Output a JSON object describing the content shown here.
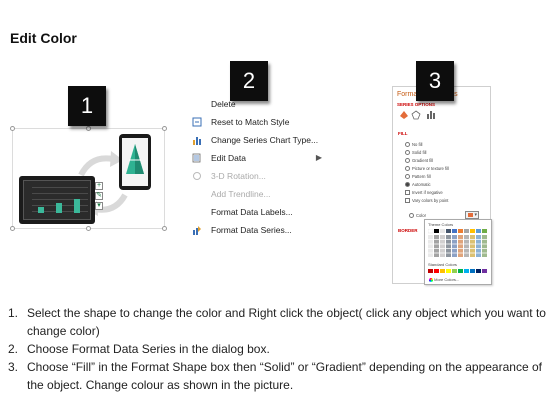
{
  "page": {
    "title": "Edit Color"
  },
  "badges": [
    "1",
    "2",
    "3"
  ],
  "context_menu": {
    "items": [
      {
        "label": "Delete",
        "icon": "delete-icon",
        "disabled": false,
        "submenu": false
      },
      {
        "label": "Reset to Match Style",
        "icon": "reset-style-icon",
        "disabled": false,
        "submenu": false
      },
      {
        "label": "Change Series Chart Type...",
        "icon": "chart-type-icon",
        "disabled": false,
        "submenu": false
      },
      {
        "label": "Edit Data",
        "icon": "edit-data-icon",
        "disabled": false,
        "submenu": true
      },
      {
        "label": "3-D Rotation...",
        "icon": "rotation-icon",
        "disabled": true,
        "submenu": false
      },
      {
        "label": "Add Trendline...",
        "icon": "",
        "disabled": true,
        "submenu": false
      },
      {
        "label": "Format Data Labels...",
        "icon": "",
        "disabled": false,
        "submenu": false
      },
      {
        "label": "Format Data Series...",
        "icon": "format-series-icon",
        "disabled": false,
        "submenu": false
      }
    ]
  },
  "format_pane": {
    "title": "Format Data Series",
    "series_options": "SERIES OPTIONS",
    "fill_section": "FILL",
    "fill_options": [
      "No fill",
      "Solid fill",
      "Gradient fill",
      "Picture or texture fill",
      "Pattern fill",
      "Automatic"
    ],
    "selected_fill": "Automatic",
    "checkboxes": [
      "Invert if negative",
      "Vary colors by point"
    ],
    "color_label": "Color",
    "border_section": "BORDER",
    "palette": {
      "theme_label": "Theme Colors",
      "standard_label": "Standard Colors",
      "more_colors": "More Colors..."
    }
  },
  "steps": [
    "Select the shape to change the color and Right click the object( click any object which you want to change color)",
    "Choose Format Data Series in the dialog box.",
    "Choose “Fill” in the Format Shape box then “Solid” or “Gradient” depending on the appearance of the object. Change colour as shown in the picture."
  ],
  "colors": {
    "accent": "#c55a11",
    "badge_bg": "#0d0d0d",
    "chart_bar": "#3bb89a"
  }
}
